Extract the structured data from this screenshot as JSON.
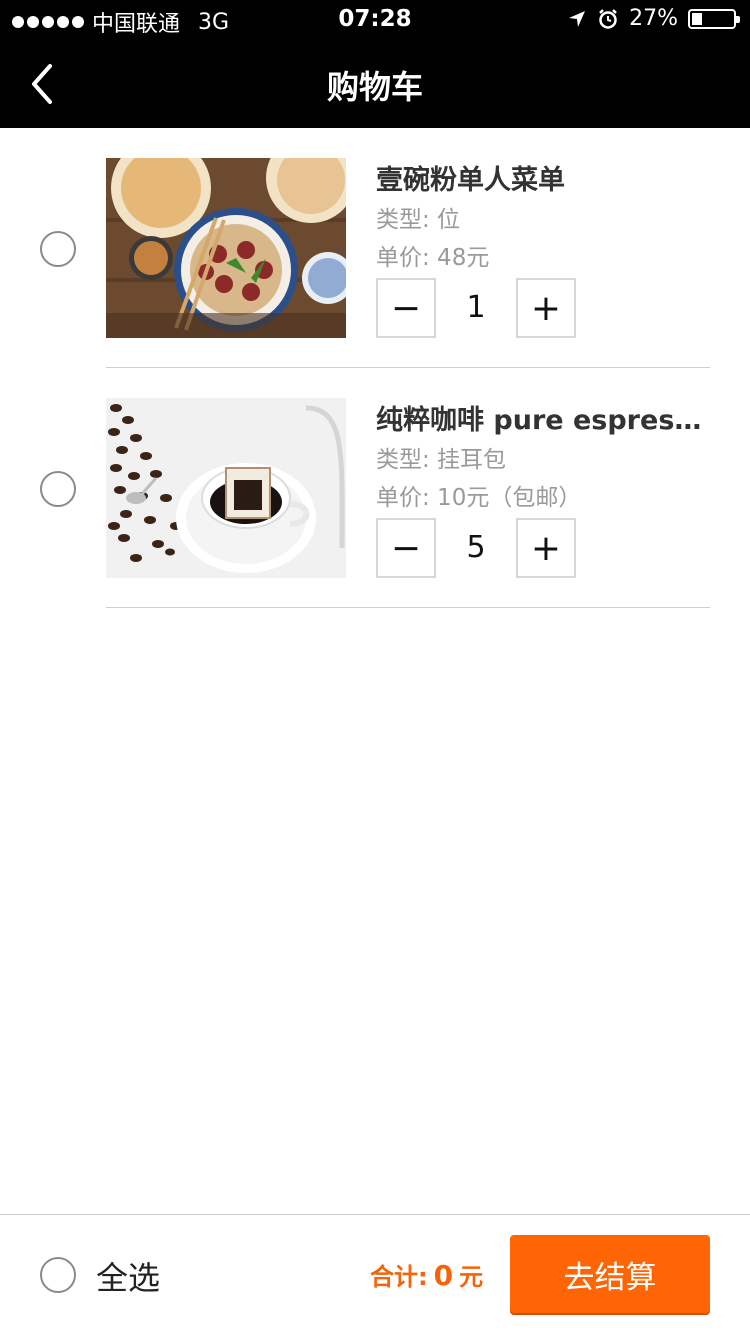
{
  "status_bar": {
    "carrier": "中国联通",
    "network": "3G",
    "time": "07:28",
    "battery": "27%"
  },
  "nav": {
    "title": "购物车",
    "back_icon": "chevron-left-icon"
  },
  "items": [
    {
      "name": "壹碗粉单人菜单",
      "type": "类型: 位",
      "price": "单价: 48元",
      "quantity": "1",
      "minus": "−",
      "plus": "+",
      "selected": false,
      "image": "noodle-bowl-photo"
    },
    {
      "name": "纯粹咖啡 pure espresso",
      "type": "类型: 挂耳包",
      "price": "单价: 10元（包邮）",
      "quantity": "5",
      "minus": "−",
      "plus": "+",
      "selected": false,
      "image": "drip-coffee-photo"
    }
  ],
  "footer": {
    "select_all": "全选",
    "total_label": "合计:",
    "total_value": "0",
    "total_unit": "元",
    "checkout": "去结算"
  },
  "colors": {
    "accent": "#ff6405",
    "bar": "#000000",
    "muted": "#9a9a9a"
  }
}
